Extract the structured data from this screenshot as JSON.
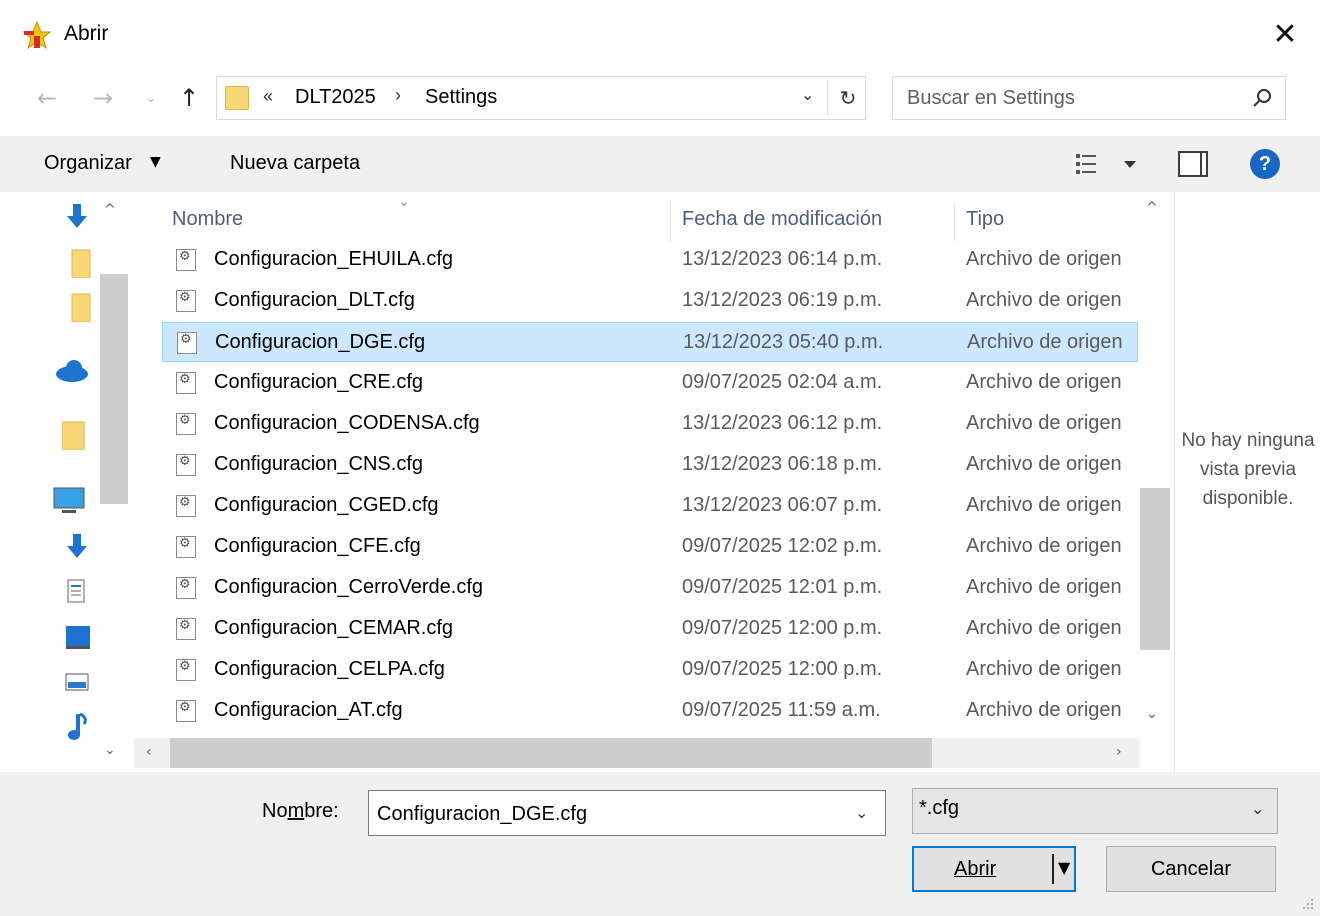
{
  "window": {
    "title": "Abrir",
    "close_symbol": "✕"
  },
  "nav": {
    "back_symbol": "←",
    "forward_symbol": "→",
    "recent_symbol": "⌄",
    "up_symbol": "↑"
  },
  "address": {
    "overflow_symbol": "«",
    "crumbs": [
      "DLT2025",
      "Settings"
    ],
    "separator": "›",
    "dropdown_symbol": "⌄",
    "refresh_symbol": "↻"
  },
  "search": {
    "placeholder": "Buscar en Settings"
  },
  "toolbar": {
    "organize_label": "Organizar",
    "organize_caret": "▼",
    "new_folder_label": "Nueva carpeta",
    "help_symbol": "?"
  },
  "navpane": {
    "icons": [
      "downloads-icon",
      "folder-icon",
      "folder-icon",
      "onedrive-icon",
      "folder-icon",
      "this-pc-icon",
      "downloads-icon",
      "documents-icon",
      "desktop-icon",
      "pictures-icon",
      "music-icon"
    ],
    "scroll_up": "^",
    "scroll_down": "⌄"
  },
  "filelist": {
    "sort_caret": "⌄",
    "columns": {
      "name": "Nombre",
      "date": "Fecha de modificación",
      "type": "Tipo"
    },
    "rows": [
      {
        "name": "Configuracion_EHUILA.cfg",
        "date": "13/12/2023 06:14 p.m.",
        "type": "Archivo de origen"
      },
      {
        "name": "Configuracion_DLT.cfg",
        "date": "13/12/2023 06:19 p.m.",
        "type": "Archivo de origen"
      },
      {
        "name": "Configuracion_DGE.cfg",
        "date": "13/12/2023 05:40 p.m.",
        "type": "Archivo de origen"
      },
      {
        "name": "Configuracion_CRE.cfg",
        "date": "09/07/2025 02:04 a.m.",
        "type": "Archivo de origen"
      },
      {
        "name": "Configuracion_CODENSA.cfg",
        "date": "13/12/2023 06:12 p.m.",
        "type": "Archivo de origen"
      },
      {
        "name": "Configuracion_CNS.cfg",
        "date": "13/12/2023 06:18 p.m.",
        "type": "Archivo de origen"
      },
      {
        "name": "Configuracion_CGED.cfg",
        "date": "13/12/2023 06:07 p.m.",
        "type": "Archivo de origen"
      },
      {
        "name": "Configuracion_CFE.cfg",
        "date": "09/07/2025 12:02 p.m.",
        "type": "Archivo de origen"
      },
      {
        "name": "Configuracion_CerroVerde.cfg",
        "date": "09/07/2025 12:01 p.m.",
        "type": "Archivo de origen"
      },
      {
        "name": "Configuracion_CEMAR.cfg",
        "date": "09/07/2025 12:00 p.m.",
        "type": "Archivo de origen"
      },
      {
        "name": "Configuracion_CELPA.cfg",
        "date": "09/07/2025 12:00 p.m.",
        "type": "Archivo de origen"
      },
      {
        "name": "Configuracion_AT.cfg",
        "date": "09/07/2025 11:59 a.m.",
        "type": "Archivo de origen"
      }
    ],
    "selected_index": 2,
    "vscroll_up": "^",
    "vscroll_down": "⌄",
    "hscroll_left": "‹",
    "hscroll_right": "›"
  },
  "preview": {
    "message": "No hay ninguna vista previa disponible."
  },
  "footer": {
    "filename_label_pre": "No",
    "filename_label_mnemonic": "m",
    "filename_label_post": "bre:",
    "filename_value": "Configuracion_DGE.cfg",
    "dropdown_symbol": "⌄",
    "filter_value": "*.cfg",
    "open_label": "Abrir",
    "open_split_symbol": "▼",
    "cancel_label": "Cancelar"
  },
  "colors": {
    "accent": "#0078d7",
    "selection_bg": "#cce8ff",
    "selection_border": "#99d1ff",
    "help_blue": "#1768c5"
  }
}
